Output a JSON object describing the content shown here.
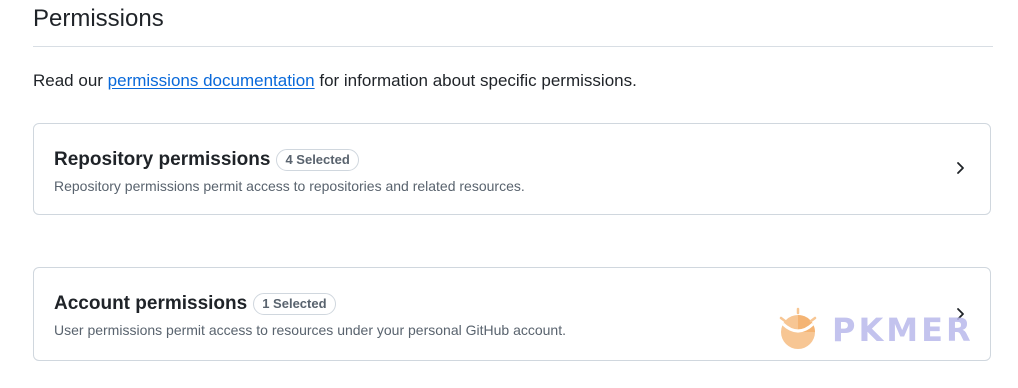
{
  "page": {
    "title": "Permissions"
  },
  "intro": {
    "prefix": "Read our ",
    "link_text": "permissions documentation",
    "suffix": " for information about specific permissions."
  },
  "cards": [
    {
      "title": "Repository permissions",
      "badge": "4 Selected",
      "description": "Repository permissions permit access to repositories and related resources."
    },
    {
      "title": "Account permissions",
      "badge": "1 Selected",
      "description": "User permissions permit access to resources under your personal GitHub account."
    }
  ],
  "watermark": {
    "text": "PKMER"
  },
  "colors": {
    "link": "#0969da",
    "border": "#d0d7de",
    "muted": "#59636e",
    "watermark": "#b9b9ec",
    "watermark_logo": "#f3b16c"
  },
  "icons": {
    "card_chevron": "chevron-right-icon",
    "watermark_logo": "pkmer-logo"
  }
}
